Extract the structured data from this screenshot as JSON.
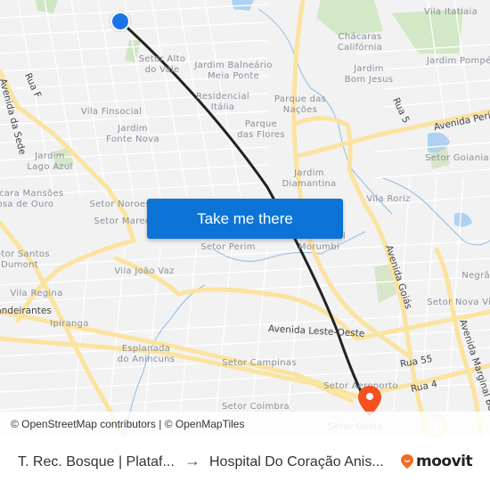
{
  "map": {
    "cta_label": "Take me there",
    "attribution": "© OpenStreetMap contributors | © OpenMapTiles",
    "neighborhood_labels": [
      {
        "text": "Vila Itatiaia"
      },
      {
        "text": "Chácaras\nCalifórnia"
      },
      {
        "text": "Jardim Pompéia"
      },
      {
        "text": "Jardim\nBom Jesus"
      },
      {
        "text": "Setor Alto\ndo Vale"
      },
      {
        "text": "Jardim Balneário\nMeia Ponte"
      },
      {
        "text": "Residencial\nItália"
      },
      {
        "text": "Parque das\nNações"
      },
      {
        "text": "Parque\ndas Flores"
      },
      {
        "text": "Vila Finsocial"
      },
      {
        "text": "Jardim\nFonte Nova"
      },
      {
        "text": "Jardim\nLago Azul"
      },
      {
        "text": "Setor Goiania"
      },
      {
        "text": "Jardim\nDiamantina"
      },
      {
        "text": "Chácara Mansões\nRosa de Ouro"
      },
      {
        "text": "Setor Noroeste"
      },
      {
        "text": "Setor Marechal"
      },
      {
        "text": "Vila Roriz"
      },
      {
        "text": "Setor Perim"
      },
      {
        "text": "Residencial\nMorumbi"
      },
      {
        "text": "Setor Santos\nDumont"
      },
      {
        "text": "Vila João Vaz"
      },
      {
        "text": "Vila Regina"
      },
      {
        "text": "Ipiranga"
      },
      {
        "text": "Setor Nova Vila"
      },
      {
        "text": "Negrão de Lima"
      },
      {
        "text": "Esplanada\ndo Anincuns"
      },
      {
        "text": "Setor Campinas"
      },
      {
        "text": "Setor Aeroporto"
      },
      {
        "text": "Setor Coimbra"
      },
      {
        "text": "Setor Oeste"
      }
    ],
    "street_labels": [
      {
        "text": "Rua F"
      },
      {
        "text": "Avenida da Sede"
      },
      {
        "text": "Rua 5"
      },
      {
        "text": "Avenida Perimetral"
      },
      {
        "text": "Avenida Goiás"
      },
      {
        "text": "Avenida Leste-Oeste"
      },
      {
        "text": "Rua 55"
      },
      {
        "text": "Rua 4"
      },
      {
        "text": "Avenida Marginal Botafogo"
      },
      {
        "text": "Bandeirantes"
      }
    ],
    "colors": {
      "origin": "#1a73e8",
      "destination": "#f4511e",
      "route": "#222222",
      "cta": "#0b74d6"
    }
  },
  "footer": {
    "origin": "T. Rec. Bosque | Plataf...",
    "arrow": "→",
    "destination": "Hospital Do Coração Anis...",
    "brand": "moovit",
    "brand_color": "#f26b21"
  }
}
